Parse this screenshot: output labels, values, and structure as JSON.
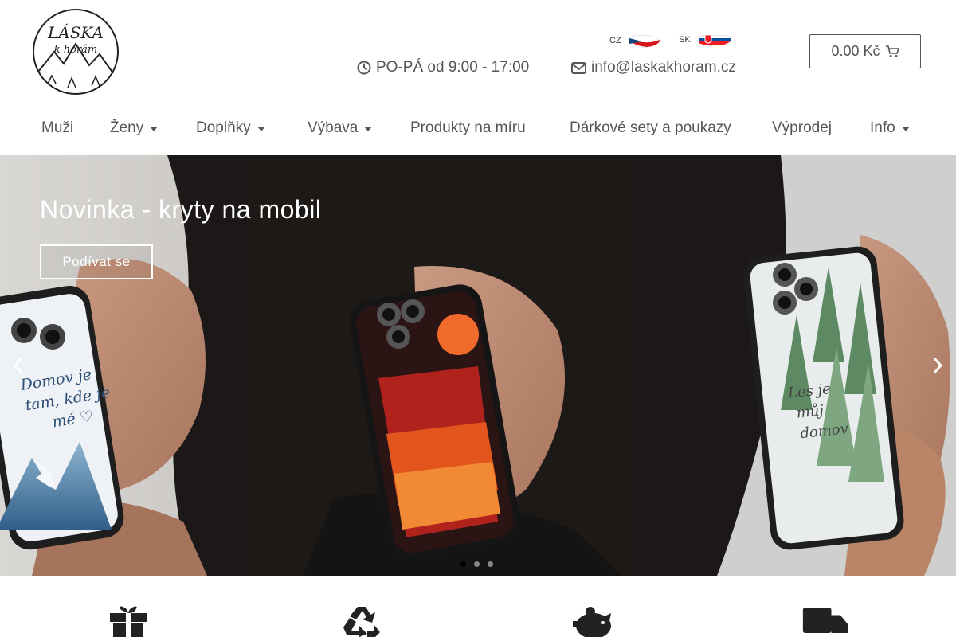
{
  "header": {
    "logo_text": "LÁSKA k horám",
    "lang_cz": "CZ",
    "lang_sk": "SK",
    "hours": "PO-PÁ od 9:00 - 17:00",
    "email": "info@laskakhoram.cz",
    "cart_total": "0.00 Kč"
  },
  "nav": {
    "items": [
      {
        "label": "Muži"
      },
      {
        "label": "Ženy"
      },
      {
        "label": "Doplňky"
      },
      {
        "label": "Výbava"
      },
      {
        "label": "Produkty na míru"
      },
      {
        "label": "Dárkové sety a poukazy"
      },
      {
        "label": "Výprodej"
      },
      {
        "label": "Info"
      }
    ]
  },
  "hero": {
    "title": "Novinka - kryty na mobil",
    "button": "Podívat se",
    "case_text_left": "Domov je tam, kde je mé",
    "case_text_right": "Les je můj domov",
    "active_slide": 1,
    "slide_count": 3
  },
  "features": {
    "icons": [
      "gift-icon",
      "recycle-icon",
      "piggy-bank-icon",
      "truck-icon"
    ]
  },
  "colors": {
    "text": "#555555",
    "hero_white": "#ffffff"
  }
}
